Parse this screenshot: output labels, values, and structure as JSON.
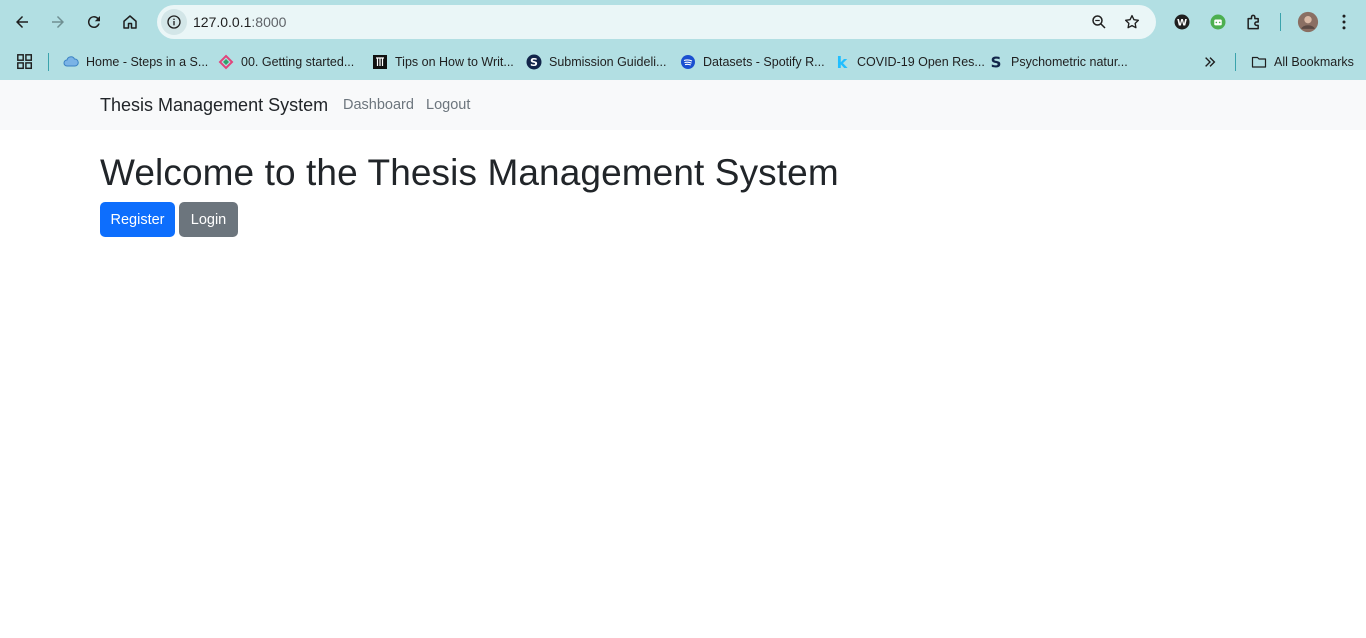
{
  "browser": {
    "url_host": "127.0.0.1",
    "url_port": ":8000",
    "bookmarks": [
      {
        "label": "Home - Steps in a S...",
        "icon": "cloud-icon"
      },
      {
        "label": "00. Getting started...",
        "icon": "diamond-icon"
      },
      {
        "label": "Tips on How to Writ...",
        "icon": "book-icon"
      },
      {
        "label": "Submission Guideli...",
        "icon": "s-logo-icon"
      },
      {
        "label": "Datasets - Spotify R...",
        "icon": "spotify-icon"
      },
      {
        "label": "COVID-19 Open Res...",
        "icon": "k-logo-icon"
      },
      {
        "label": "Psychometric natur...",
        "icon": "s-logo-icon"
      }
    ],
    "all_bookmarks_label": "All Bookmarks"
  },
  "navbar": {
    "brand": "Thesis Management System",
    "links": [
      "Dashboard",
      "Logout"
    ]
  },
  "main": {
    "title": "Welcome to the Thesis Management System",
    "register_label": "Register",
    "login_label": "Login"
  },
  "colors": {
    "chrome_bg": "#b2dfe3",
    "primary": "#0d6efd",
    "secondary": "#6c757d",
    "navbar_bg": "#f8f9fa"
  }
}
